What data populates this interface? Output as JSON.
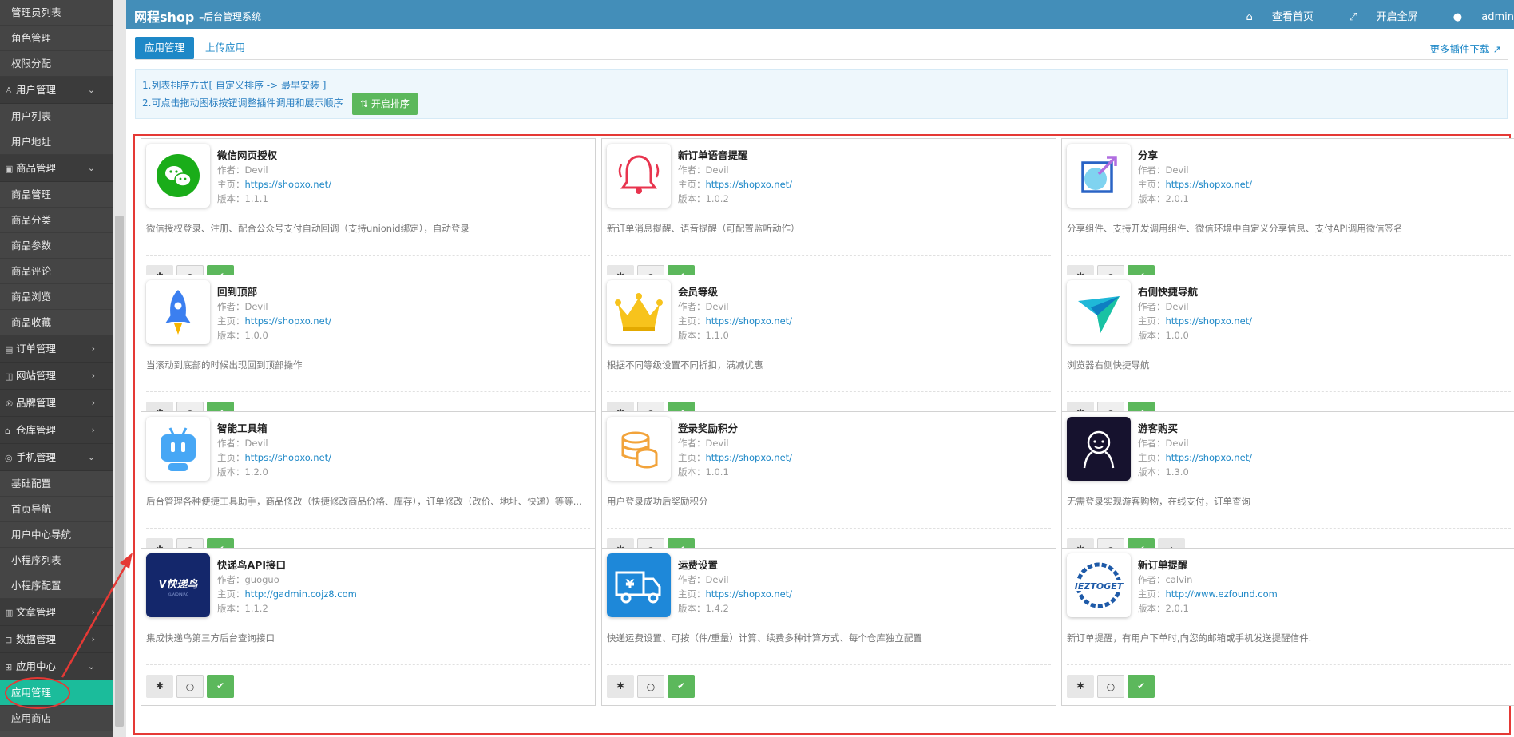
{
  "colors": {
    "header": "#438eb9",
    "accent": "#1e88c7",
    "success": "#5cb85c",
    "active_menu": "#1bbc9b",
    "annotation": "#e53935"
  },
  "header": {
    "brand": "网程shop -",
    "subtitle": "后台管理系统",
    "links": [
      {
        "icon": "home-icon",
        "label": "查看首页"
      },
      {
        "icon": "fullscreen-icon",
        "label": "开启全屏"
      },
      {
        "icon": "user-icon",
        "label": "admin"
      }
    ]
  },
  "sidebar": {
    "items": [
      {
        "type": "item",
        "label": "管理员列表"
      },
      {
        "type": "item",
        "label": "角色管理"
      },
      {
        "type": "item",
        "label": "权限分配"
      },
      {
        "type": "group",
        "label": "用户管理",
        "icon": "user-group-icon",
        "expanded": true
      },
      {
        "type": "item",
        "label": "用户列表"
      },
      {
        "type": "item",
        "label": "用户地址"
      },
      {
        "type": "group",
        "label": "商品管理",
        "icon": "goods-icon",
        "expanded": true
      },
      {
        "type": "item",
        "label": "商品管理"
      },
      {
        "type": "item",
        "label": "商品分类"
      },
      {
        "type": "item",
        "label": "商品参数"
      },
      {
        "type": "item",
        "label": "商品评论"
      },
      {
        "type": "item",
        "label": "商品浏览"
      },
      {
        "type": "item",
        "label": "商品收藏"
      },
      {
        "type": "group",
        "label": "订单管理",
        "icon": "order-icon",
        "expanded": false
      },
      {
        "type": "group",
        "label": "网站管理",
        "icon": "site-icon",
        "expanded": false
      },
      {
        "type": "group",
        "label": "品牌管理",
        "icon": "brand-icon",
        "expanded": false
      },
      {
        "type": "group",
        "label": "仓库管理",
        "icon": "warehouse-icon",
        "expanded": false
      },
      {
        "type": "group",
        "label": "手机管理",
        "icon": "mobile-icon",
        "expanded": true
      },
      {
        "type": "item",
        "label": "基础配置"
      },
      {
        "type": "item",
        "label": "首页导航"
      },
      {
        "type": "item",
        "label": "用户中心导航"
      },
      {
        "type": "item",
        "label": "小程序列表"
      },
      {
        "type": "item",
        "label": "小程序配置"
      },
      {
        "type": "group",
        "label": "文章管理",
        "icon": "article-icon",
        "expanded": false
      },
      {
        "type": "group",
        "label": "数据管理",
        "icon": "data-icon",
        "expanded": false
      },
      {
        "type": "group",
        "label": "应用中心",
        "icon": "app-center-icon",
        "expanded": true
      },
      {
        "type": "item",
        "label": "应用管理",
        "active": true
      },
      {
        "type": "item",
        "label": "应用商店"
      }
    ]
  },
  "tabs": [
    {
      "label": "应用管理",
      "active": true
    },
    {
      "label": "上传应用",
      "active": false
    }
  ],
  "more_plugins": "更多插件下载",
  "info": {
    "line1": "1.列表排序方式[ 自定义排序 -> 最早安装 ]",
    "line2": "2.可点击拖动图标按钮调整插件调用和展示顺序",
    "sort_button": "开启排序"
  },
  "labels": {
    "author": "作者：",
    "homepage": "主页：",
    "version": "版本："
  },
  "plugins": [
    {
      "name": "微信网页授权",
      "author": "Devil",
      "homepage": "https://shopxo.net/",
      "version": "1.1.1",
      "desc": "微信授权登录、注册、配合公众号支付自动回调（支持unionid绑定），自动登录",
      "icon": "wechat-icon"
    },
    {
      "name": "新订单语音提醒",
      "author": "Devil",
      "homepage": "https://shopxo.net/",
      "version": "1.0.2",
      "desc": "新订单消息提醒、语音提醒（可配置监听动作）",
      "icon": "bell-icon"
    },
    {
      "name": "分享",
      "author": "Devil",
      "homepage": "https://shopxo.net/",
      "version": "2.0.1",
      "desc": "分享组件、支持开发调用组件、微信环境中自定义分享信息、支付API调用微信签名",
      "icon": "share-icon"
    },
    {
      "name": "回到顶部",
      "author": "Devil",
      "homepage": "https://shopxo.net/",
      "version": "1.0.0",
      "desc": "当滚动到底部的时候出现回到顶部操作",
      "icon": "rocket-icon"
    },
    {
      "name": "会员等级",
      "author": "Devil",
      "homepage": "https://shopxo.net/",
      "version": "1.1.0",
      "desc": "根据不同等级设置不同折扣，满减优惠",
      "icon": "crown-icon"
    },
    {
      "name": "右侧快捷导航",
      "author": "Devil",
      "homepage": "https://shopxo.net/",
      "version": "1.0.0",
      "desc": "浏览器右侧快捷导航",
      "icon": "paper-plane-icon"
    },
    {
      "name": "智能工具箱",
      "author": "Devil",
      "homepage": "https://shopxo.net/",
      "version": "1.2.0",
      "desc": "后台管理各种便捷工具助手，商品修改（快捷修改商品价格、库存），订单修改（改价、地址、快递）等等...",
      "icon": "robot-icon"
    },
    {
      "name": "登录奖励积分",
      "author": "Devil",
      "homepage": "https://shopxo.net/",
      "version": "1.0.1",
      "desc": "用户登录成功后奖励积分",
      "icon": "coins-icon"
    },
    {
      "name": "游客购买",
      "author": "Devil",
      "homepage": "https://shopxo.net/",
      "version": "1.3.0",
      "desc": "无需登录实现游客购物，在线支付，订单查询",
      "icon": "guest-icon",
      "has_home": true
    },
    {
      "name": "快递鸟API接口",
      "author": "guoguo",
      "homepage": "http://gadmin.cojz8.com",
      "version": "1.1.2",
      "desc": "集成快递鸟第三方后台查询接口",
      "icon": "kdniao-logo-icon",
      "logo_text": "快递鸟"
    },
    {
      "name": "运费设置",
      "author": "Devil",
      "homepage": "https://shopxo.net/",
      "version": "1.4.2",
      "desc": "快递运费设置、可按（件/重量）计算、续费多种计算方式、每个仓库独立配置",
      "icon": "truck-icon"
    },
    {
      "name": "新订单提醒",
      "author": "calvin",
      "homepage": "http://www.ezfound.com",
      "version": "2.0.1",
      "desc": "新订单提醒，有用户下单时,向您的邮箱或手机发送提醒信件.",
      "icon": "ieztoget-logo-icon",
      "logo_text": "IEZTOGET"
    }
  ]
}
